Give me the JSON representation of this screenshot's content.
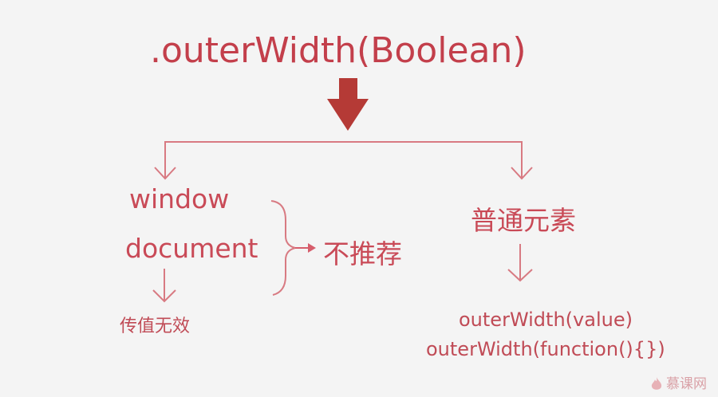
{
  "title": ".outerWidth(Boolean)",
  "left_branch": {
    "items": [
      "window",
      "document"
    ],
    "recommendation": "不推荐",
    "result": "传值无效"
  },
  "right_branch": {
    "label": "普通元素",
    "usages": [
      "outerWidth(value)",
      "outerWidth(function(){})"
    ]
  },
  "watermark": "慕课网",
  "colors": {
    "accent": "#c33f4b",
    "arrow_main": "#b53a36",
    "line": "#d87a82",
    "background": "#f4f4f4"
  }
}
